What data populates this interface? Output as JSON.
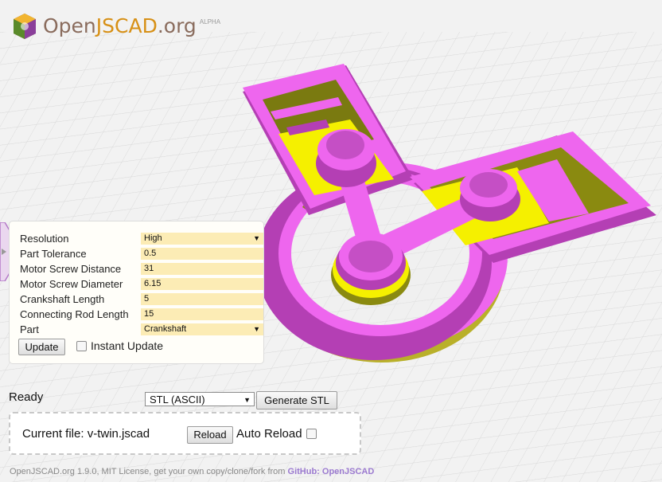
{
  "header": {
    "logo_text_a": "Open",
    "logo_text_b": "JSCAD",
    "logo_text_c": ".org",
    "logo_badge": "ALPHA",
    "logo_icon": "cube-logo-icon"
  },
  "parameters": [
    {
      "label": "Resolution",
      "value": "High",
      "type": "select"
    },
    {
      "label": "Part Tolerance",
      "value": "0.5",
      "type": "input"
    },
    {
      "label": "Motor Screw Distance",
      "value": "31",
      "type": "input"
    },
    {
      "label": "Motor Screw Diameter",
      "value": "6.15",
      "type": "input"
    },
    {
      "label": "Crankshaft Length",
      "value": "5",
      "type": "input"
    },
    {
      "label": "Connecting Rod Length",
      "value": "15",
      "type": "input"
    },
    {
      "label": "Part",
      "value": "Crankshaft",
      "type": "select"
    }
  ],
  "controls": {
    "update_label": "Update",
    "instant_update_label": "Instant Update",
    "instant_update_checked": false
  },
  "status": {
    "text": "Ready",
    "format_selected": "STL (ASCII)",
    "generate_label": "Generate STL"
  },
  "file": {
    "current_file": "Current file: v-twin.jscad",
    "reload_label": "Reload",
    "auto_reload_label": "Auto Reload",
    "auto_reload_checked": false
  },
  "footer": {
    "text": "OpenJSCAD.org 1.9.0, MIT License, get your own copy/clone/fork from ",
    "link": "GitHub: OpenJSCAD"
  },
  "colors": {
    "model_magenta": "#ee66ee",
    "model_yellow": "#f5f000",
    "field_bg": "#fcecb5",
    "link": "#9b7ad0"
  }
}
